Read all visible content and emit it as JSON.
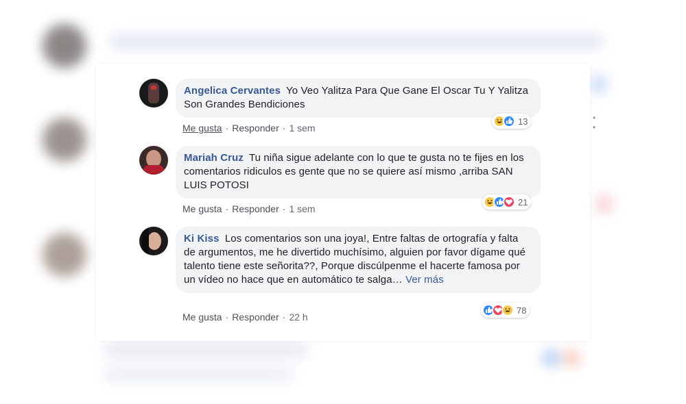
{
  "comments": [
    {
      "author": "Angelica Cervantes",
      "text": "Yo Veo Yalitza Para Que Gane El Oscar Tu Y Yalitza Son Grandes Bendiciones",
      "actions": {
        "like": "Me gusta",
        "reply": "Responder",
        "time": "1 sem"
      },
      "reactions": {
        "types": [
          "haha-icon",
          "like-icon"
        ],
        "count": "13"
      }
    },
    {
      "author": "Mariah Cruz",
      "text": "Tu niña sigue adelante con lo que te gusta no te fijes en los comentarios ridiculos es gente que no se quiere así mismo ,arriba SAN LUIS POTOSI",
      "actions": {
        "like": "Me gusta",
        "reply": "Responder",
        "time": "1 sem"
      },
      "reactions": {
        "types": [
          "haha-icon",
          "like-icon",
          "love-icon"
        ],
        "count": "21"
      }
    },
    {
      "author": "Ki Kiss",
      "text": "Los comentarios son una joya!, Entre faltas de ortografía y falta de argumentos, me he divertido muchísimo, alguien por favor dígame qué talento tiene este señorita??, Porque discúlpenme el hacerte famosa por un vídeo no hace que en automático te salga…",
      "see_more": "Ver más",
      "actions": {
        "like": "Me gusta",
        "reply": "Responder",
        "time": "22 h"
      },
      "reactions": {
        "types": [
          "like-icon",
          "love-icon",
          "haha-icon"
        ],
        "count": "78"
      }
    }
  ],
  "options_icon": "more-options-icon",
  "colors": {
    "author": "#385898",
    "bubble": "#f2f3f5",
    "like": "#2d88ff",
    "love": "#f33e58",
    "haha": "#f7c84c"
  }
}
